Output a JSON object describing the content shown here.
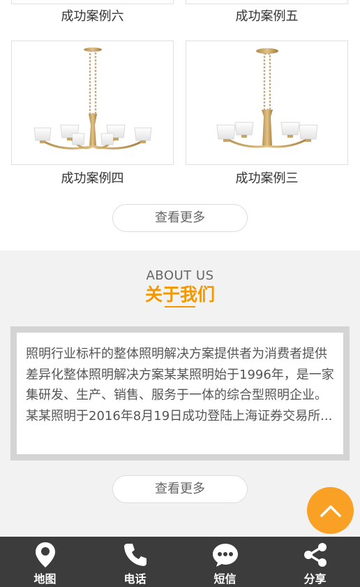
{
  "cases": {
    "items": [
      {
        "title": "成功案例六"
      },
      {
        "title": "成功案例五"
      },
      {
        "title": "成功案例四"
      },
      {
        "title": "成功案例三"
      }
    ],
    "more_label": "查看更多"
  },
  "about": {
    "title_en": "ABOUT US",
    "title_cn": "关于我们",
    "description": "照明行业标杆的整体照明解决方案提供者为消费者提供差异化整体照明解决方案某某照明始于1996年，是一家集研发、生产、销售、服务于一体的综合型照明企业。某某照明于2016年8月19日成功登陆上海证券交易所...",
    "more_label": "查看更多"
  },
  "footer": {
    "items": [
      {
        "label": "地图",
        "icon": "map-pin-icon"
      },
      {
        "label": "电话",
        "icon": "phone-icon"
      },
      {
        "label": "短信",
        "icon": "sms-icon"
      },
      {
        "label": "分享",
        "icon": "share-icon"
      }
    ]
  },
  "colors": {
    "accent": "#f39800",
    "to_top": "#f9a125",
    "footer_bg": "#3c3c3c",
    "section_bg": "#f2f2f2"
  }
}
